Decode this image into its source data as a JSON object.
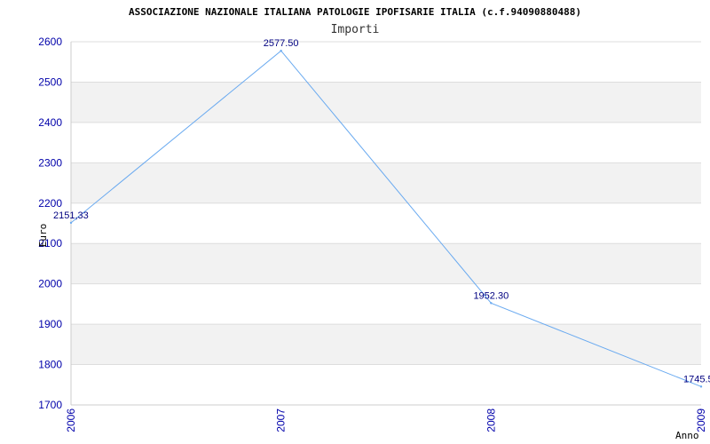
{
  "colors": {
    "line": "#6aaaf0",
    "band": "#f2f2f2",
    "grid": "#dddddd",
    "tick_text": "#0000aa",
    "data_label": "#000080"
  },
  "chart_data": {
    "type": "line",
    "title": "ASSOCIAZIONE NAZIONALE ITALIANA PATOLOGIE IPOFISARIE ITALIA (c.f.94090880488)",
    "subtitle": "Importi",
    "xlabel": "Anno",
    "ylabel": "Euro",
    "categories": [
      "2006",
      "2007",
      "2008",
      "2009"
    ],
    "series": [
      {
        "values": [
          2151.33,
          2577.5,
          1952.3,
          1745.5
        ]
      }
    ],
    "data_labels": [
      "2151,33",
      "2577.50",
      "1952.30",
      "1745.5"
    ],
    "ylim": [
      1700,
      2600
    ],
    "yticks": [
      1700,
      1800,
      1900,
      2000,
      2100,
      2200,
      2300,
      2400,
      2500,
      2600
    ],
    "grid": true,
    "legend": "none"
  }
}
